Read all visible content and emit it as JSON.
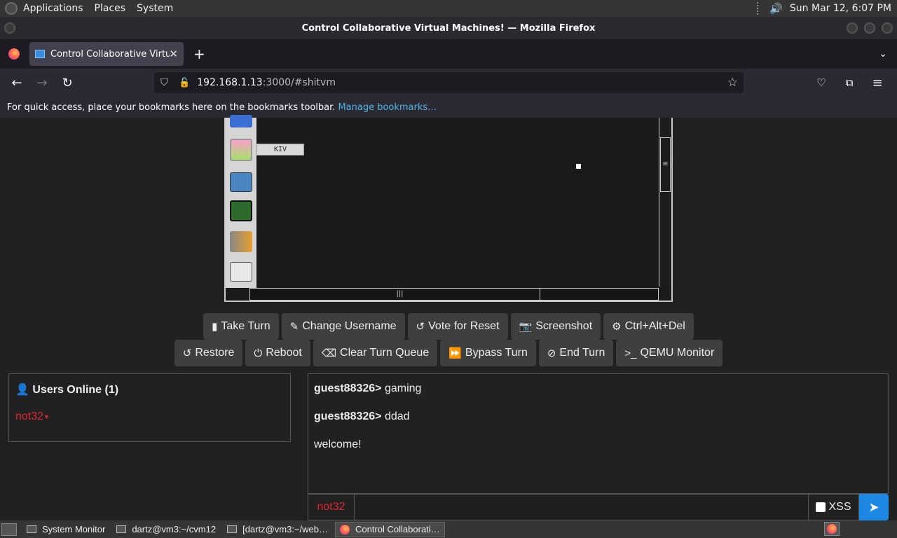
{
  "gnome_panel": {
    "menus": [
      "Applications",
      "Places",
      "System"
    ],
    "clock": "Sun Mar 12,  6:07 PM"
  },
  "window": {
    "title": "Control Collaborative Virtual Machines! — Mozilla Firefox"
  },
  "tabs": [
    {
      "label": "Control Collaborative Virtual Machines!"
    }
  ],
  "url": {
    "host": "192.168.1.13",
    "path": ":3000/#shitvm"
  },
  "bookmarks_bar": {
    "text": "For quick access, place your bookmarks here on the bookmarks toolbar.",
    "link": "Manage bookmarks…"
  },
  "vm": {
    "tooltip": "KIV"
  },
  "buttons_row1": [
    {
      "label": "Take Turn",
      "icon": "mouse-icon"
    },
    {
      "label": "Change Username",
      "icon": "user-edit-icon"
    },
    {
      "label": "Vote for Reset",
      "icon": "rotate-left-icon"
    },
    {
      "label": "Screenshot",
      "icon": "camera-icon"
    },
    {
      "label": "Ctrl+Alt+Del",
      "icon": "gear-icon"
    }
  ],
  "buttons_row2": [
    {
      "label": "Restore",
      "icon": "rotate-left-icon"
    },
    {
      "label": "Reboot",
      "icon": "power-icon"
    },
    {
      "label": "Clear Turn Queue",
      "icon": "eraser-icon"
    },
    {
      "label": "Bypass Turn",
      "icon": "forward-icon"
    },
    {
      "label": "End Turn",
      "icon": "ban-icon"
    },
    {
      "label": "QEMU Monitor",
      "icon": "terminal-icon"
    }
  ],
  "users_panel": {
    "title": "Users Online (1)",
    "users": [
      "not32"
    ]
  },
  "chat": {
    "messages": [
      {
        "user": "guest88326>",
        "text": "gaming"
      },
      {
        "user": "guest88326>",
        "text": "ddad"
      },
      {
        "user": "",
        "text": "welcome!"
      }
    ],
    "username": "not32",
    "xss_label": "XSS"
  },
  "taskbar": {
    "items": [
      "System Monitor",
      "dartz@vm3:~/cvm12",
      "[dartz@vm3:~/web…",
      "Control Collaborati…"
    ]
  }
}
